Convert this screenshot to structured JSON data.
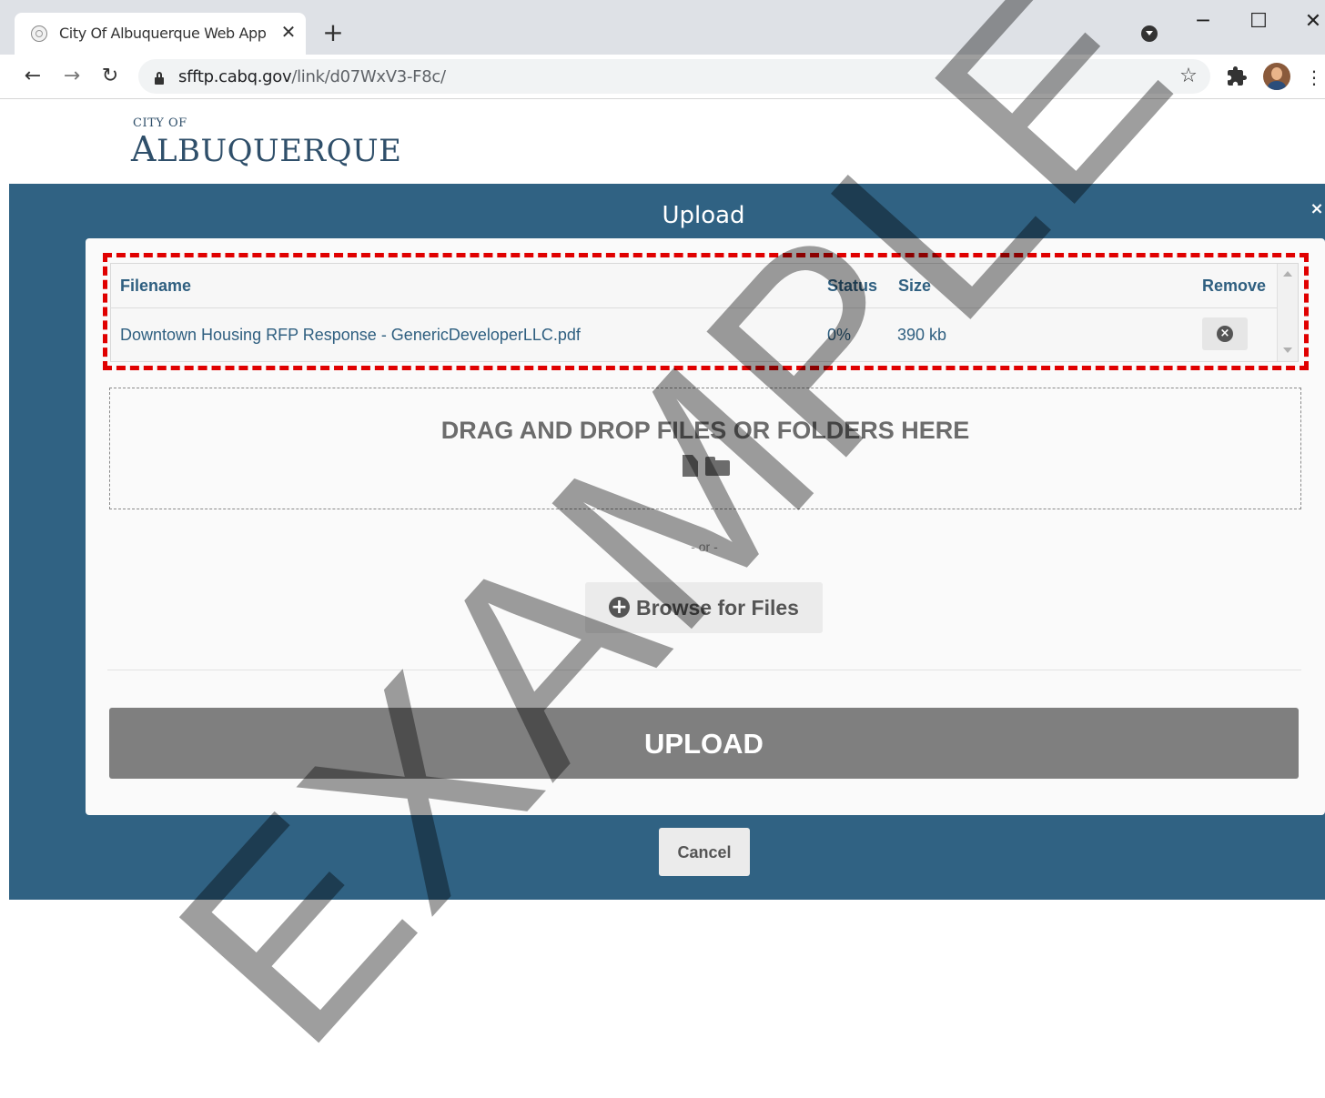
{
  "browser": {
    "tab_title": "City Of Albuquerque Web App - ",
    "new_tab_symbol": "+",
    "close_symbol": "✕",
    "url_host": "sfftp.cabq.gov",
    "url_path": "/link/d07WxV3-F8c/",
    "window_controls": {
      "minimize": "─",
      "maximize": "☐",
      "close": "✕"
    },
    "nav": {
      "back": "←",
      "forward": "→",
      "reload": "↻"
    },
    "menu_symbol": "⋮",
    "star_symbol": "☆"
  },
  "logo": {
    "line1": "CITY OF",
    "line2_first": "A",
    "line2_rest": "LBUQUERQUE"
  },
  "modal": {
    "title": "Upload",
    "close_symbol": "×",
    "table": {
      "headers": {
        "filename": "Filename",
        "status": "Status",
        "size": "Size",
        "remove": "Remove"
      },
      "rows": [
        {
          "filename": "Downtown Housing RFP Response - GenericDeveloperLLC.pdf",
          "status": "0%",
          "size": "390 kb"
        }
      ]
    },
    "dropzone_text": "DRAG AND DROP FILES OR FOLDERS HERE",
    "or_text": "- or -",
    "browse_label": "Browse for Files",
    "upload_label": "UPLOAD",
    "cancel_label": "Cancel"
  },
  "watermark": "EXAMPLE",
  "colors": {
    "modal_bg": "#306283",
    "highlight": "#e00000",
    "upload_button": "#7f7f7f",
    "table_text": "#2f5f80"
  }
}
